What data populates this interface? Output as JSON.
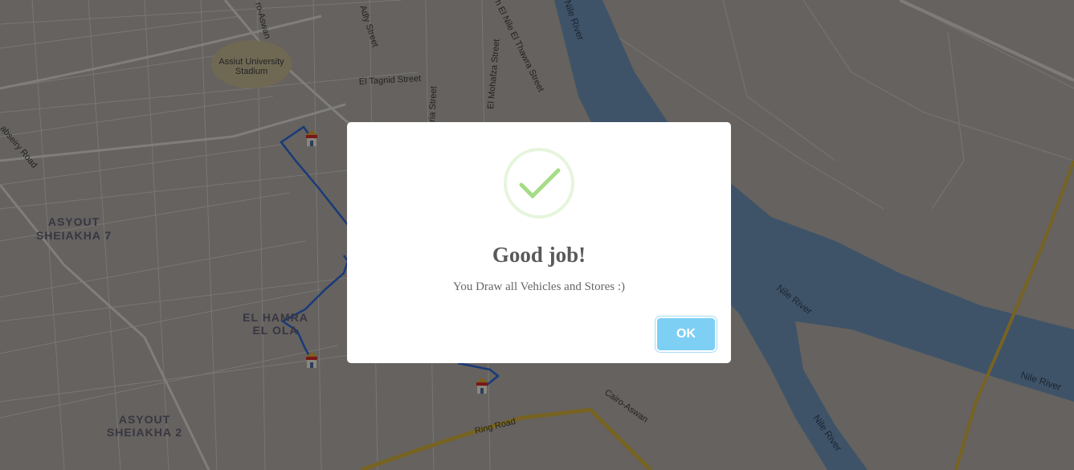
{
  "map": {
    "area_labels": [
      {
        "line1": "ASYOUT",
        "line2": "SHEIAKHA 7"
      },
      {
        "line1": "EL HAMRA",
        "line2": "EL OLA"
      },
      {
        "line1": "ASYOUT",
        "line2": "SHEIAKHA 2"
      }
    ],
    "poi_labels": [
      {
        "line1": "Assiut University",
        "line2": "Stadium"
      }
    ],
    "street_labels": [
      "Adly Street",
      "El Tagnid Street",
      "El Mohafza Street",
      "ria Street",
      "h El Nile El Thawra Street",
      "abseiry Road",
      "ro-Aswan",
      "Cairo-Aswan",
      "Ring Road"
    ],
    "river_labels": [
      "Nile River",
      "Nile River",
      "Nile River",
      "Nile River"
    ],
    "route_color": "#2a62c9",
    "store_marker_icon": "store-icon",
    "store_count": 4
  },
  "dialog": {
    "icon": "success-check-icon",
    "title": "Good job!",
    "text": "You Draw all Vehicles and Stores :)",
    "ok_label": "OK",
    "ok_color": "#7ecff4"
  }
}
